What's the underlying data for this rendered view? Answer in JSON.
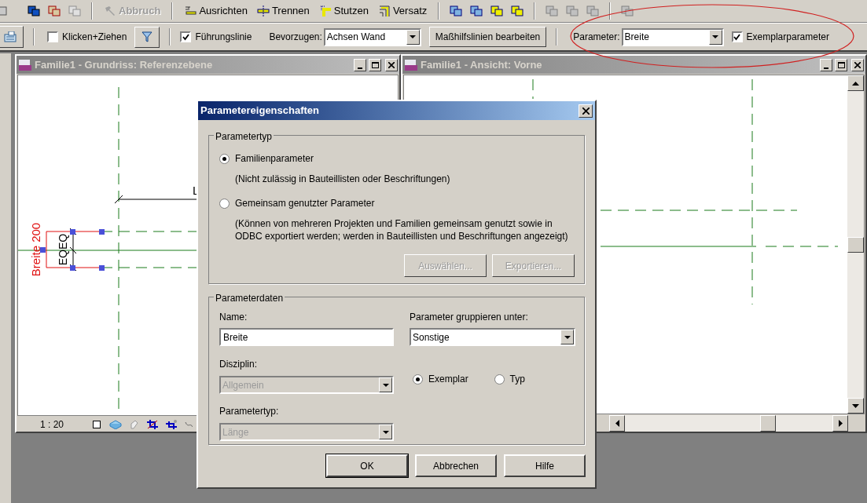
{
  "toolbar": {
    "tools": [
      {
        "label": "Abbruch",
        "disabled": true
      },
      {
        "label": "Ausrichten",
        "disabled": false
      },
      {
        "label": "Trennen",
        "disabled": false
      },
      {
        "label": "Stutzen",
        "disabled": false
      },
      {
        "label": "Versatz",
        "disabled": false
      }
    ]
  },
  "options_bar": {
    "klicken_ziehen": {
      "label": "Klicken+Ziehen",
      "checked": false
    },
    "fuehrungslinie": {
      "label": "Führungslinie",
      "checked": true
    },
    "bevorzugen": {
      "label": "Bevorzugen:",
      "value": "Achsen Wand"
    },
    "edit_button": "Maßhilfslinien bearbeiten",
    "parameter": {
      "label": "Parameter:",
      "value": "Breite"
    },
    "exemplarparameter": {
      "label": "Exemplarparameter",
      "checked": true
    }
  },
  "views": [
    {
      "title": "Familie1 - Grundriss: Referenzebene",
      "scale": "1 : 20",
      "labels": [
        "L",
        "Breite 200",
        "EQEQ"
      ]
    },
    {
      "title": "Familie1 - Ansicht: Vorne"
    }
  ],
  "dialog": {
    "title": "Parametereigenschaften",
    "parametertyp": {
      "legend": "Parametertyp",
      "options": [
        {
          "label": "Familienparameter",
          "description": "(Nicht zulässig in Bauteillisten oder Beschriftungen)",
          "selected": true
        },
        {
          "label": "Gemeinsam genutzter Parameter",
          "description": "(Können von mehreren Projekten und Familien gemeinsam genutzt sowie in ODBC exportiert werden; werden in Bauteillisten und Beschriftungen angezeigt)",
          "selected": false
        }
      ],
      "buttons": [
        {
          "label": "Auswählen...",
          "disabled": true
        },
        {
          "label": "Exportieren...",
          "disabled": true
        }
      ]
    },
    "parameterdaten": {
      "legend": "Parameterdaten",
      "name": {
        "label": "Name:",
        "value": "Breite"
      },
      "gruppieren": {
        "label": "Parameter gruppieren unter:",
        "value": "Sonstige"
      },
      "disziplin": {
        "label": "Disziplin:",
        "value": "Allgemein",
        "disabled": true
      },
      "parametertyp": {
        "label": "Parametertyp:",
        "value": "Länge",
        "disabled": true
      },
      "scope": [
        {
          "label": "Exemplar",
          "selected": true
        },
        {
          "label": "Typ",
          "selected": false
        }
      ]
    },
    "buttons": [
      "OK",
      "Abbrechen",
      "Hilfe"
    ]
  }
}
